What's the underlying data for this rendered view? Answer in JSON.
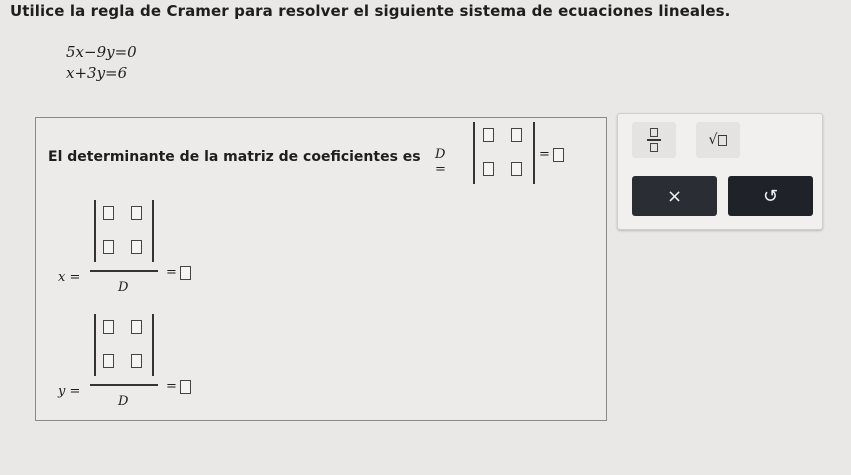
{
  "prompt": "Utilice la regla de Cramer para resolver el siguiente sistema de ecuaciones lineales.",
  "equations": [
    "5x−9y=0",
    "x+3y=6"
  ],
  "determinant": {
    "label": "El determinante de la matriz de coeficientes es",
    "symbol": "D =",
    "equals": "="
  },
  "x_fraction": {
    "var": "x =",
    "denominator": "D",
    "equals": "="
  },
  "y_fraction": {
    "var": "y =",
    "denominator": "D",
    "equals": "="
  },
  "toolbox": {
    "clear_label": "×",
    "undo_label": "↺"
  },
  "colors": {
    "background": "#e9e8e6",
    "dark_button": "#2a2d33"
  }
}
